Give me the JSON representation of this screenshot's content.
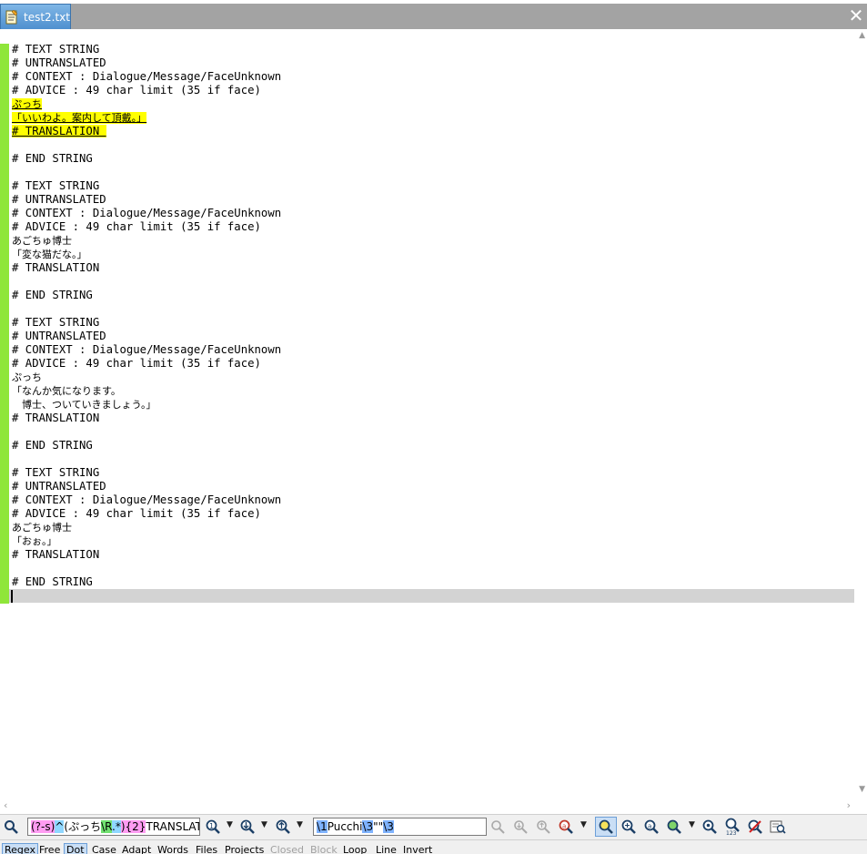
{
  "tab": {
    "label": "test2.txt"
  },
  "editor": {
    "lines": [
      {
        "t": "# TEXT STRING"
      },
      {
        "t": "# UNTRANSLATED"
      },
      {
        "t": "# CONTEXT : Dialogue/Message/FaceUnknown"
      },
      {
        "t": "# ADVICE : 49 char limit (35 if face)"
      },
      {
        "t": "ぷっち",
        "jp": true,
        "hl": true
      },
      {
        "t": "「いいわよ。案内して頂戴。」",
        "jp": true,
        "hl": true
      },
      {
        "t": "# TRANSLATION ",
        "hl": true
      },
      {
        "t": ""
      },
      {
        "t": "# END STRING"
      },
      {
        "t": ""
      },
      {
        "t": "# TEXT STRING"
      },
      {
        "t": "# UNTRANSLATED"
      },
      {
        "t": "# CONTEXT : Dialogue/Message/FaceUnknown"
      },
      {
        "t": "# ADVICE : 49 char limit (35 if face)"
      },
      {
        "t": "あごちゅ博士",
        "jp": true
      },
      {
        "t": "「変な猫だな。」",
        "jp": true
      },
      {
        "t": "# TRANSLATION"
      },
      {
        "t": ""
      },
      {
        "t": "# END STRING"
      },
      {
        "t": ""
      },
      {
        "t": "# TEXT STRING"
      },
      {
        "t": "# UNTRANSLATED"
      },
      {
        "t": "# CONTEXT : Dialogue/Message/FaceUnknown"
      },
      {
        "t": "# ADVICE : 49 char limit (35 if face)"
      },
      {
        "t": "ぷっち",
        "jp": true
      },
      {
        "t": "「なんか気になります。",
        "jp": true
      },
      {
        "t": "　博士、ついていきましょう。」",
        "jp": true
      },
      {
        "t": "# TRANSLATION"
      },
      {
        "t": ""
      },
      {
        "t": "# END STRING"
      },
      {
        "t": ""
      },
      {
        "t": "# TEXT STRING"
      },
      {
        "t": "# UNTRANSLATED"
      },
      {
        "t": "# CONTEXT : Dialogue/Message/FaceUnknown"
      },
      {
        "t": "# ADVICE : 49 char limit (35 if face)"
      },
      {
        "t": "あごちゅ博士",
        "jp": true
      },
      {
        "t": "「おぉ。」",
        "jp": true
      },
      {
        "t": "# TRANSLATION"
      },
      {
        "t": ""
      },
      {
        "t": "# END STRING"
      }
    ]
  },
  "search": {
    "find_tokens": [
      {
        "t": "(?-s)",
        "c": "tok-a"
      },
      {
        "t": "^",
        "c": "tok-b"
      },
      {
        "t": "(ぷっち",
        "c": ""
      },
      {
        "t": "\\R",
        "c": "tok-c"
      },
      {
        "t": ".*",
        "c": "tok-b"
      },
      {
        "t": "){2}",
        "c": "tok-a"
      },
      {
        "t": "TRANSLATION",
        "c": ""
      }
    ],
    "replace_tokens": [
      {
        "t": "\\1",
        "c": "tok-d"
      },
      {
        "t": "Pucchi",
        "c": ""
      },
      {
        "t": "\\3",
        "c": "tok-d"
      },
      {
        "t": "\"\"",
        "c": ""
      },
      {
        "t": "\\3",
        "c": "tok-d"
      }
    ]
  },
  "options": [
    {
      "label": "Regex",
      "on": true
    },
    {
      "label": "Free"
    },
    {
      "label": "Dot",
      "on": true
    },
    {
      "label": "Case"
    },
    {
      "label": "Adapt"
    },
    {
      "label": "Words"
    },
    {
      "label": "Files"
    },
    {
      "label": "Projects"
    },
    {
      "label": "Closed",
      "dim": true
    },
    {
      "label": "Block",
      "dim": true
    },
    {
      "label": "Loop"
    },
    {
      "label": "Line"
    },
    {
      "label": "Invert"
    }
  ]
}
